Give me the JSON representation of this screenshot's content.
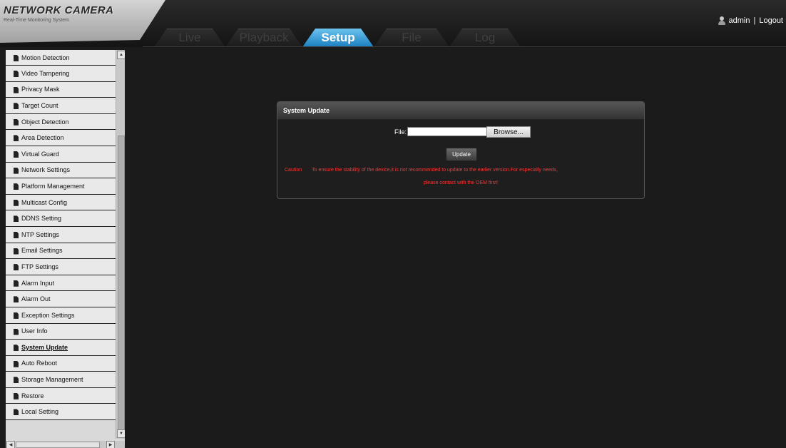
{
  "header": {
    "logo_title": "NETWORK CAMERA",
    "logo_subtitle": "Real-Time Monitoring System",
    "tabs": [
      {
        "label": "Live",
        "active": false
      },
      {
        "label": "Playback",
        "active": false
      },
      {
        "label": "Setup",
        "active": true
      },
      {
        "label": "File",
        "active": false
      },
      {
        "label": "Log",
        "active": false
      }
    ],
    "user": {
      "icon": "user-icon",
      "name": "admin",
      "separator": "|",
      "logout": "Logout"
    }
  },
  "sidebar": {
    "active_item": "System Update",
    "items": [
      "Motion Detection",
      "Video Tampering",
      "Privacy Mask",
      "Target Count",
      "Object Detection",
      "Area Detection",
      "Virtual Guard",
      "Network Settings",
      "Platform Management",
      "Multicast Config",
      "DDNS Setting",
      "NTP Settings",
      "Email Settings",
      "FTP Settings",
      "Alarm Input",
      "Alarm Out",
      "Exception Settings",
      "User Info",
      "System Update",
      "Auto Reboot",
      "Storage Management",
      "Restore",
      "Local Setting"
    ]
  },
  "panel": {
    "title": "System Update",
    "file_label": "File:",
    "file_value": "",
    "browse_label": "Browse...",
    "update_label": "Update",
    "caution_label": "Caution",
    "caution_text": "To ensure the stability of the device,it is not recommended to update to the earlier version.For especially needs,",
    "caution_text2": "please contact with the OEM first!"
  },
  "colors": {
    "accent_tab": "#1a7fc0",
    "caution": "#ff3535",
    "background": "#1b1b1b"
  }
}
